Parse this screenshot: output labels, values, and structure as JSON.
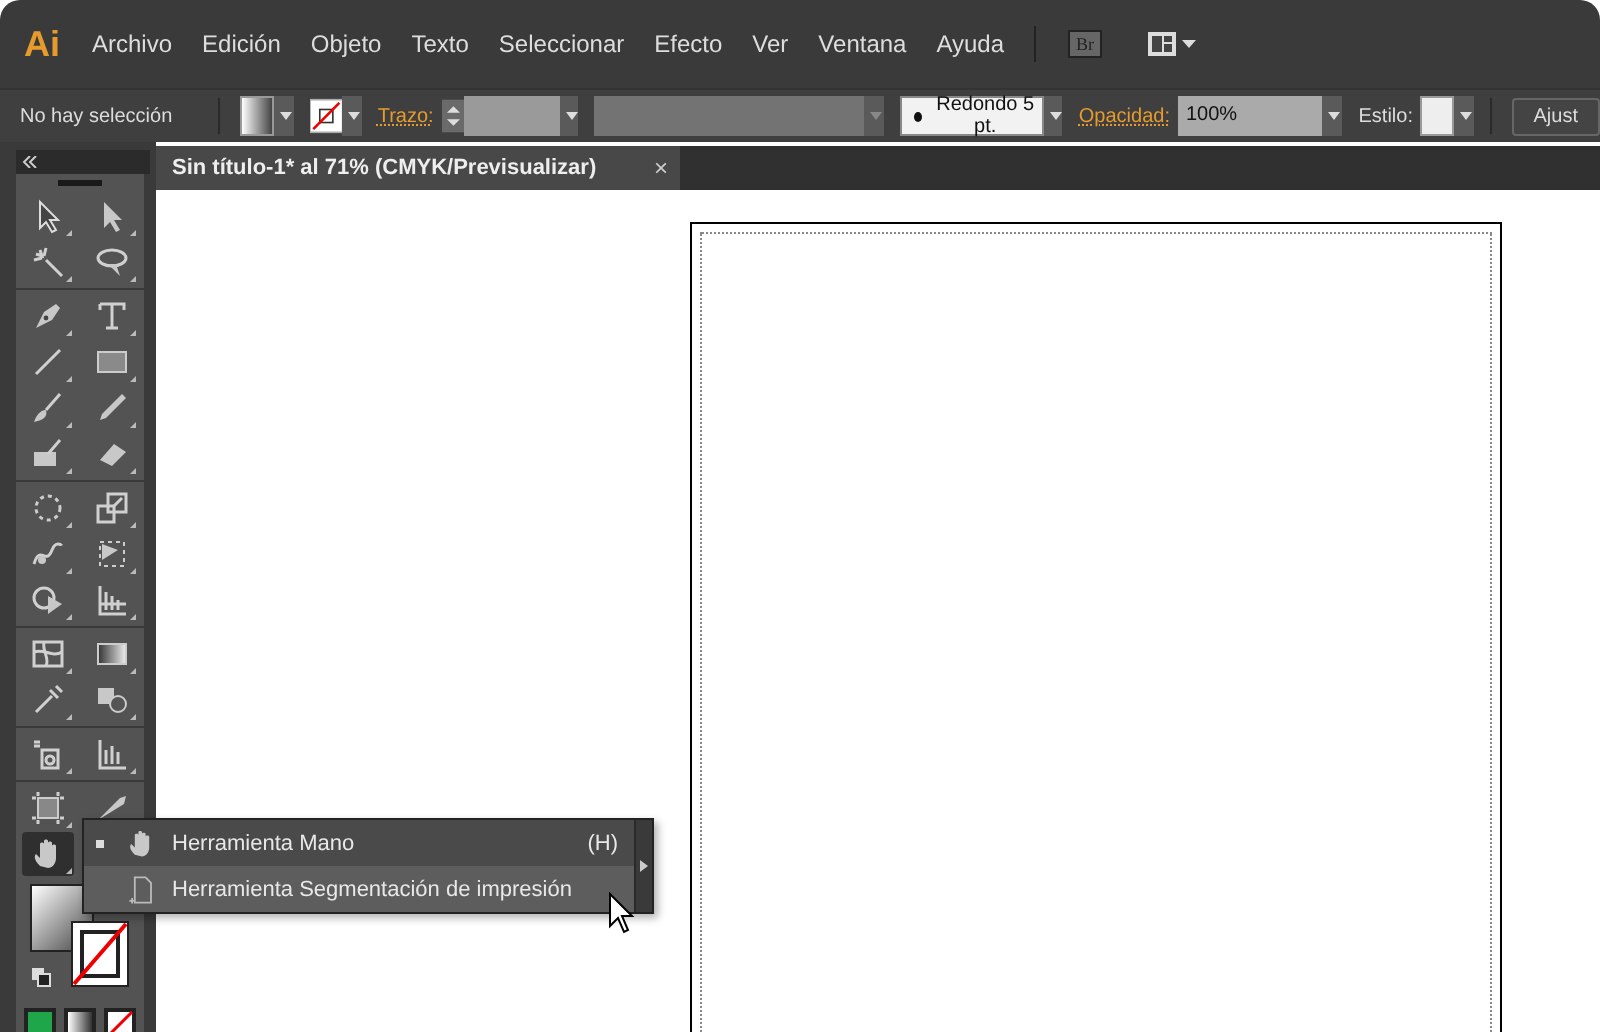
{
  "app": {
    "logo": "Ai",
    "menu": [
      "Archivo",
      "Edición",
      "Objeto",
      "Texto",
      "Seleccionar",
      "Efecto",
      "Ver",
      "Ventana",
      "Ayuda"
    ],
    "bridge_button": "Br"
  },
  "control_bar": {
    "selection": "No hay selección",
    "stroke_label": "Trazo:",
    "brush": "Redondo 5 pt.",
    "opacity_label": "Opacidad:",
    "opacity": "100%",
    "style_label": "Estilo:",
    "button": "Ajust"
  },
  "document_tab": {
    "title": "Sin título-1* al 71% (CMYK/Previsualizar)",
    "close": "×"
  },
  "tools": [
    {
      "selected": false
    },
    {
      "selected": false
    },
    {
      "selected": false
    },
    {
      "selected": false
    },
    {
      "selected": false
    },
    {
      "selected": false
    },
    {
      "selected": false
    },
    {
      "selected": false
    },
    {
      "selected": false
    },
    {
      "selected": false
    },
    {
      "selected": false
    },
    {
      "selected": false
    },
    {
      "selected": false
    },
    {
      "selected": false
    },
    {
      "selected": false
    },
    {
      "selected": false
    },
    {
      "selected": false
    },
    {
      "selected": false
    },
    {
      "selected": false
    },
    {
      "selected": false
    },
    {
      "selected": false
    },
    {
      "selected": false
    },
    {
      "selected": false
    },
    {
      "selected": false
    },
    {
      "selected": false
    },
    {
      "selected": false
    },
    {
      "selected": true
    }
  ],
  "flyout": [
    {
      "label": "Herramienta Mano",
      "shortcut": "(H)",
      "selected": true,
      "highlighted": false
    },
    {
      "label": "Herramienta Segmentación de impresión",
      "selected": false,
      "highlighted": true
    }
  ]
}
